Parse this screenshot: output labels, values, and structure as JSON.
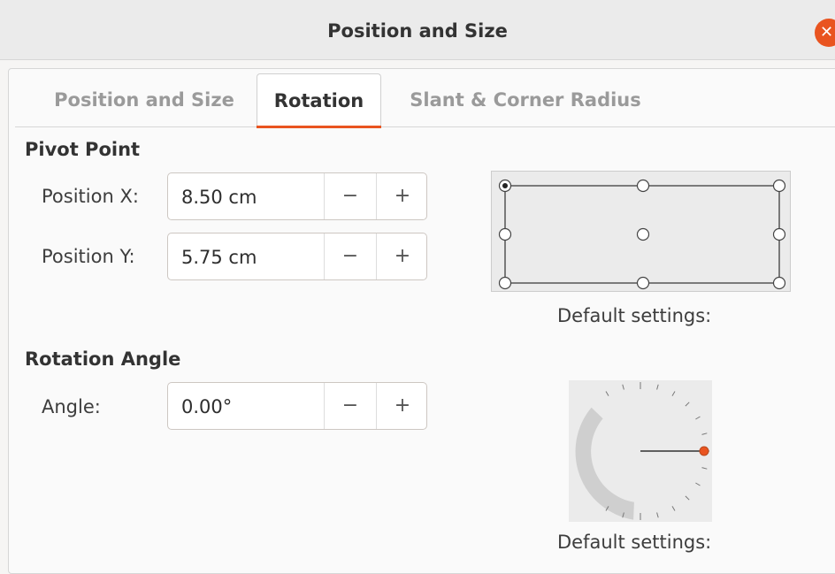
{
  "window": {
    "title": "Position and Size",
    "close_glyph": "✕"
  },
  "tabs": [
    {
      "label": "Position and Size",
      "active": false
    },
    {
      "label": "Rotation",
      "active": true
    },
    {
      "label": "Slant & Corner Radius",
      "active": false
    }
  ],
  "pivot": {
    "heading": "Pivot Point",
    "position_x": {
      "label": "Position X:",
      "value": "8.50 cm"
    },
    "position_y": {
      "label": "Position Y:",
      "value": "5.75 cm"
    },
    "selected_point": "top-left",
    "caption": "Default settings:"
  },
  "rotation": {
    "heading": "Rotation Angle",
    "angle": {
      "label": "Angle:",
      "value": "0.00°"
    },
    "dial_angle_degrees": 0,
    "caption": "Default settings:"
  },
  "spin_buttons": {
    "minus": "−",
    "plus": "+"
  },
  "colors": {
    "accent": "#e95420"
  }
}
